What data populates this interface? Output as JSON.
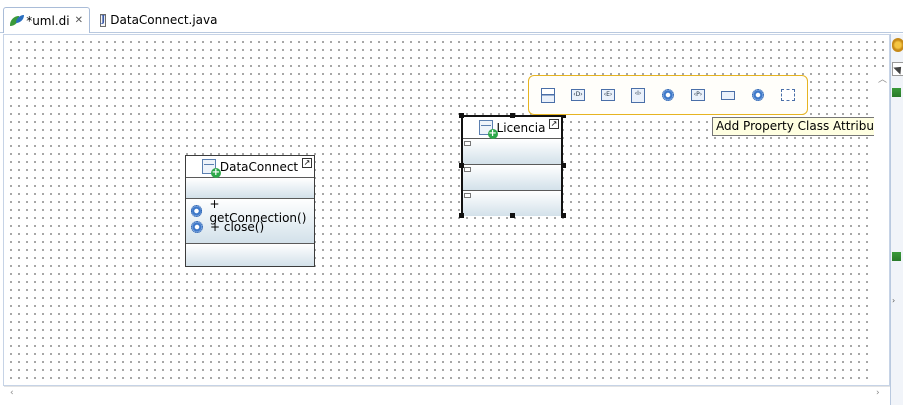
{
  "tabs": [
    {
      "label": "*uml.di",
      "icon": "papyrus-diagram-icon",
      "active": true
    },
    {
      "label": "DataConnect.java",
      "icon": "java-file-icon",
      "active": false
    }
  ],
  "diagram": {
    "classes": [
      {
        "name": "DataConnect",
        "operations": [
          "+ getConnection()",
          "+ close()"
        ]
      },
      {
        "name": "Licencia",
        "selected": true
      }
    ],
    "popup_bar": {
      "items": [
        "attribute-icon",
        "datatype-icon",
        "enumeration-icon",
        "interface-icon",
        "operation-icon",
        "primitive-type-icon",
        "property-icon",
        "signal-icon",
        "comment-icon"
      ]
    },
    "tooltip": "Add Property Class Attribute Label"
  },
  "colors": {
    "popup_border": "#e6b422",
    "compartment_gradient_end": "#d3e1ea",
    "tooltip_bg": "#ffffe1"
  }
}
